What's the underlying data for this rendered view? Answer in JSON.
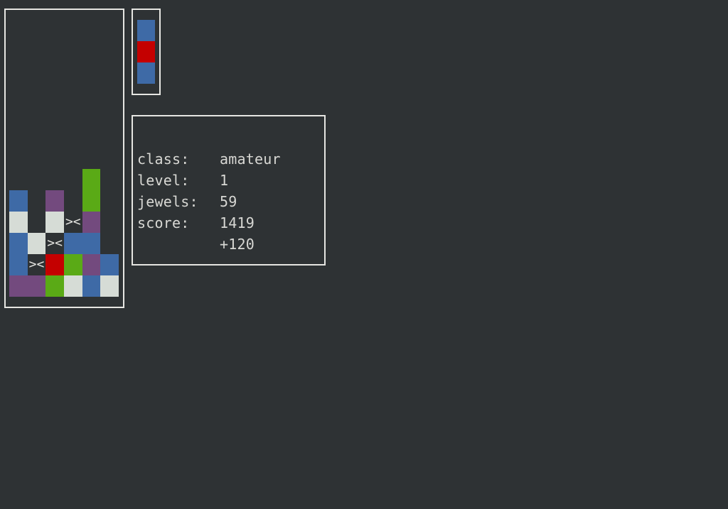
{
  "colors": {
    "background": "#2e3234",
    "frame": "#e6e6e2",
    "text": "#d8d8d4",
    "B": "#3e6aa6",
    "W": "#d6dcd6",
    "P": "#734a7e",
    "G": "#5aaa16",
    "R": "#c40000"
  },
  "board": {
    "rows": [
      "......",
      "......",
      "......",
      "......",
      "......",
      "......",
      "......",
      "....G.",
      "B.P.G.",
      "W.WXP.",
      "BWXBB.",
      "BXRGPB",
      "PPGWBW"
    ],
    "legend": {
      "B": "blue-jewel",
      "W": "white-jewel",
      "P": "purple-jewel",
      "G": "green-jewel",
      "R": "red-jewel",
      "X": "cleared-marker",
      ".": "empty"
    },
    "cleared_marker_text": "><"
  },
  "next_piece": [
    "B",
    "R",
    "B"
  ],
  "stats": {
    "class_label": "class:",
    "class_value": "amateur",
    "level_label": "level:",
    "level_value": "1",
    "jewels_label": "jewels:",
    "jewels_value": "59",
    "score_label": "score:",
    "score_value": "1419",
    "bonus_value": "+120"
  }
}
